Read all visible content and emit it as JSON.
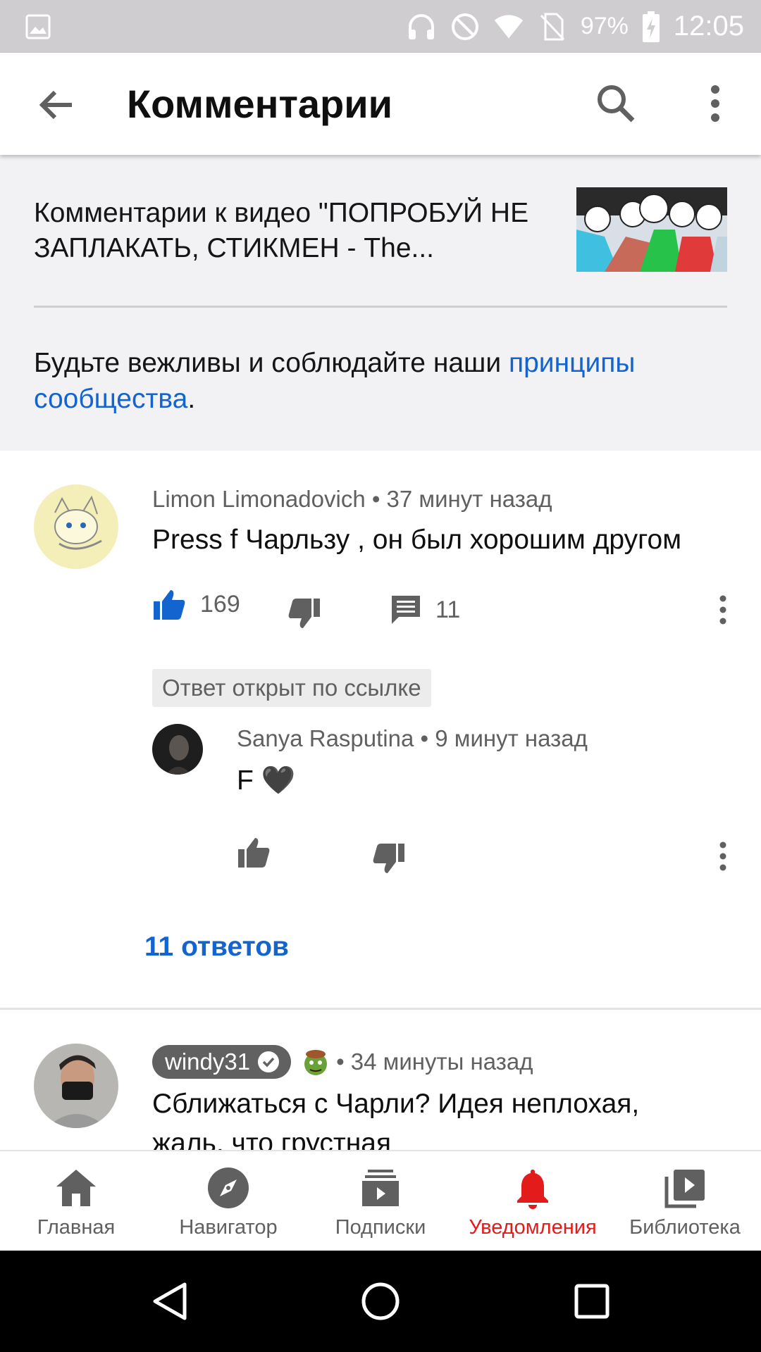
{
  "status_bar": {
    "battery": "97%",
    "time": "12:05"
  },
  "app_bar": {
    "title": "Комментарии"
  },
  "header": {
    "video_text": "Комментарии к видео \"ПОПРОБУЙ НЕ ЗАПЛАКАТЬ, СТИКМЕН - The...",
    "policy_text": "Будьте вежливы и соблюдайте наши ",
    "policy_link": "принципы сообщества",
    "policy_end": "."
  },
  "comments": [
    {
      "author": "Limon Limonadovich",
      "time": " • 37 минут назад",
      "text": "Press f Чарльзу , он был хорошим другом",
      "likes": "169",
      "replies_count": "11"
    },
    {
      "author": "windy31",
      "time": " • 34 минуты назад",
      "text": "Сближаться с Чарли? Идея неплохая,",
      "text_line2": "жаль, что грустная"
    }
  ],
  "reply": {
    "chip": "Ответ открыт по ссылке",
    "author": "Sanya Rasputina",
    "time": " • 9 минут назад",
    "text": "F 🖤"
  },
  "replies_link": "11 ответов",
  "bottom_nav": [
    {
      "label": "Главная",
      "icon": "home-icon",
      "active": false
    },
    {
      "label": "Навигатор",
      "icon": "compass-icon",
      "active": false
    },
    {
      "label": "Подписки",
      "icon": "subscriptions-icon",
      "active": false
    },
    {
      "label": "Уведомления",
      "icon": "bell-icon",
      "active": true
    },
    {
      "label": "Библиотека",
      "icon": "library-icon",
      "active": false
    }
  ],
  "colors": {
    "accent_blue": "#1464d0",
    "active_red": "#e31b1b"
  }
}
